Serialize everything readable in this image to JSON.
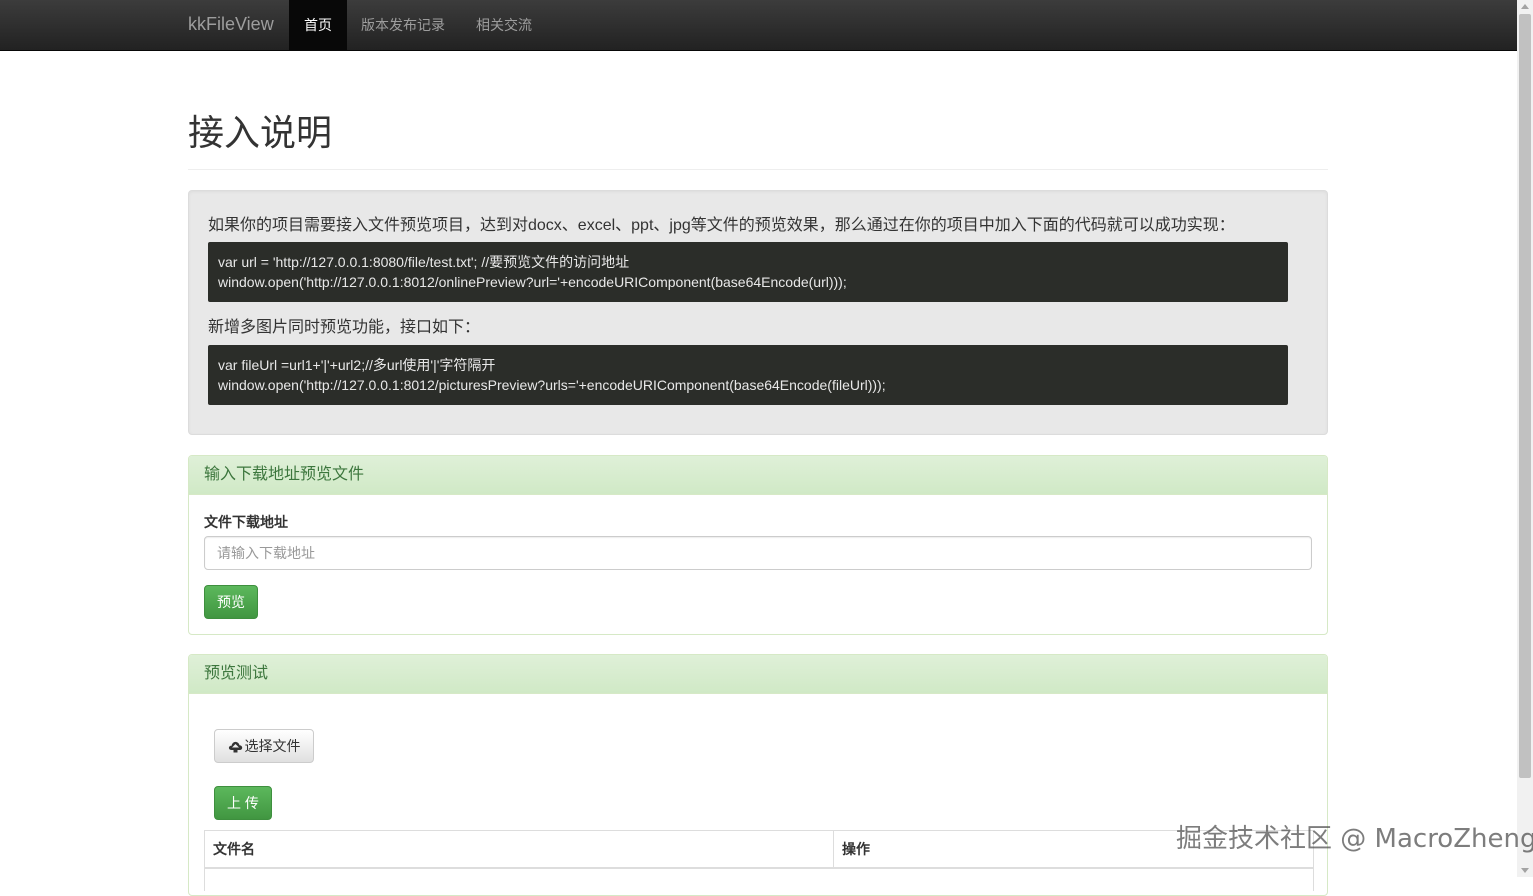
{
  "navbar": {
    "brand": "kkFileView",
    "items": [
      {
        "label": "首页",
        "active": true
      },
      {
        "label": "版本发布记录",
        "active": false
      },
      {
        "label": "相关交流",
        "active": false
      }
    ]
  },
  "page_title": "接入说明",
  "intro": {
    "text": "如果你的项目需要接入文件预览项目，达到对docx、excel、ppt、jpg等文件的预览效果，那么通过在你的项目中加入下面的代码就可以成功实现：",
    "code1_line1": "var url = 'http://127.0.0.1:8080/file/test.txt'; //要预览文件的访问地址",
    "code1_line2": "window.open('http://127.0.0.1:8012/onlinePreview?url='+encodeURIComponent(base64Encode(url)));",
    "text2": "新增多图片同时预览功能，接口如下：",
    "code2_line1": "var fileUrl =url1+'|'+url2;//多url使用'|'字符隔开",
    "code2_line2": "window.open('http://127.0.0.1:8012/picturesPreview?urls='+encodeURIComponent(base64Encode(fileUrl)));"
  },
  "url_panel": {
    "heading": "输入下载地址预览文件",
    "field_label": "文件下载地址",
    "input_value": "",
    "input_placeholder": "请输入下载地址",
    "preview_button": "预览"
  },
  "test_panel": {
    "heading": "预览测试",
    "choose_button": "选择文件",
    "upload_button": "上 传",
    "columns": [
      "文件名",
      "操作"
    ]
  },
  "watermark": "掘金技术社区 @ MacroZheng",
  "colors": {
    "navbar_bg": "#222222",
    "panel_heading_bg": "#dff0d8",
    "panel_heading_text": "#3c763d",
    "success_button": "#5cb85c",
    "code_bg": "#2b2d29"
  }
}
